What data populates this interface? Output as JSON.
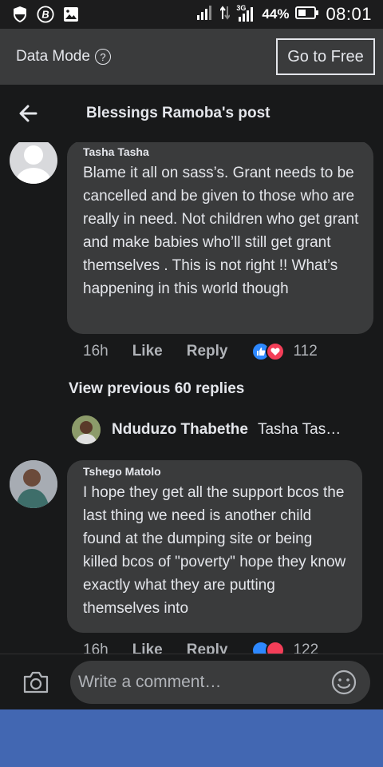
{
  "status_bar": {
    "battery": "44%",
    "network": "3G",
    "time": "08:01",
    "icons": [
      "shield-icon",
      "bible-b-icon",
      "gallery-icon",
      "signal-icon",
      "data-arrows-icon",
      "signal-3g-icon",
      "battery-icon"
    ]
  },
  "data_mode": {
    "label": "Data Mode",
    "help": "?",
    "go_free": "Go to Free"
  },
  "header": {
    "title": "Blessings Ramoba's post"
  },
  "comments": [
    {
      "author": "Tasha Tasha",
      "text": "Blame it all on sass’s. Grant needs to be cancelled and be given to those who are really in need. Not children who get grant and make babies who’ll still get grant themselves . This is not right !! What’s happening in this world though",
      "time": "16h",
      "like": "Like",
      "reply": "Reply",
      "reactions": "112"
    },
    {
      "author": "Tshego Matolo",
      "text": "I hope they get all the support bcos the last thing we need is another child found at the dumping site or being killed bcos of \"poverty\" hope they know exactly what they are putting themselves into",
      "time": "16h",
      "like": "Like",
      "reply": "Reply",
      "reactions": "122"
    }
  ],
  "view_previous": "View previous 60 replies",
  "reply_preview": {
    "author": "Nduduzo Thabethe",
    "snippet": "Tasha Tas…"
  },
  "composer": {
    "placeholder": "Write a comment…"
  },
  "colors": {
    "background": "#18191a",
    "bubble": "#3a3b3c",
    "text": "#e4e6eb",
    "muted": "#b0b3b8",
    "like_blue": "#2d88ff",
    "love_red": "#f33e58",
    "nav_blue": "#4267b2"
  }
}
